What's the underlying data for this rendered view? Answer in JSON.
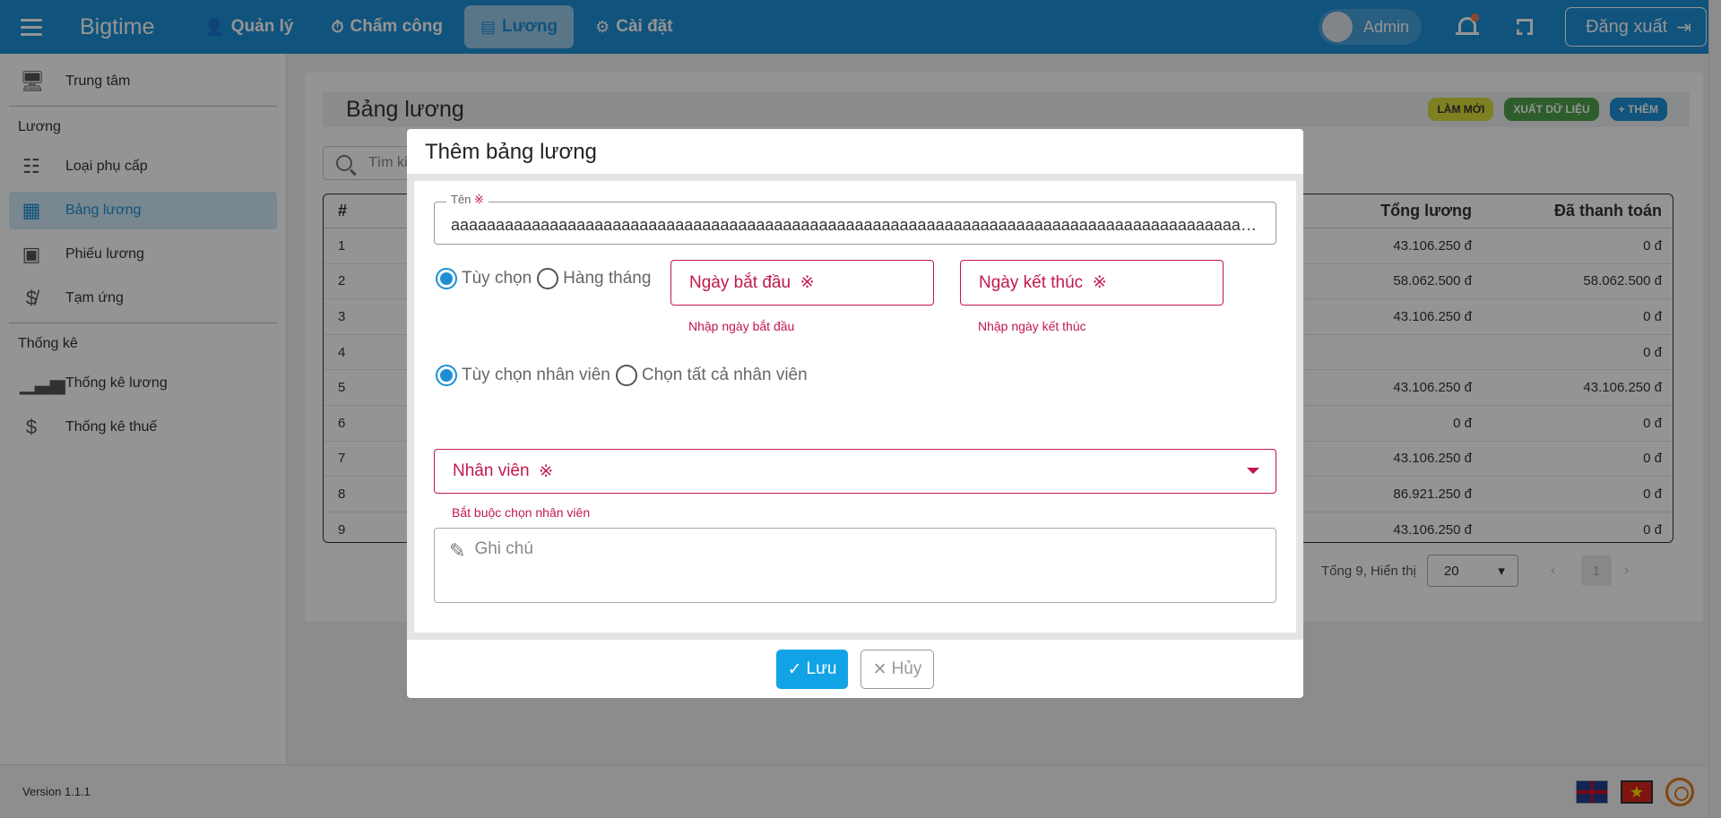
{
  "topbar": {
    "brand": "Bigtime",
    "nav": [
      {
        "label": "Quản lý",
        "icon": "manage-icon",
        "active": false
      },
      {
        "label": "Chấm công",
        "icon": "stopwatch-icon",
        "active": false
      },
      {
        "label": "Lương",
        "icon": "salary-icon",
        "active": true
      },
      {
        "label": "Cài đặt",
        "icon": "gears-icon",
        "active": false
      }
    ],
    "user": "Admin",
    "logout_label": "Đăng xuất"
  },
  "sidebar": {
    "items": [
      {
        "label": "Trung tâm",
        "icon": "monitor-icon"
      }
    ],
    "section_salary": "Lương",
    "salary_items": [
      {
        "label": "Loại phụ cấp",
        "icon": "list-icon"
      },
      {
        "label": "Bảng lương",
        "icon": "sheet-icon",
        "active": true
      },
      {
        "label": "Phiếu lương",
        "icon": "payslip-icon"
      },
      {
        "label": "Tạm ứng",
        "icon": "no-money-icon"
      }
    ],
    "section_stats": "Thống kê",
    "stats_items": [
      {
        "label": "Thống kê lương",
        "icon": "bar-chart-icon"
      },
      {
        "label": "Thống kê thuế",
        "icon": "dollar-icon"
      }
    ]
  },
  "main": {
    "title": "Bảng lương",
    "actions": {
      "refresh": "LÀM MỚI",
      "export": "XUẤT DỮ LIỆU",
      "add": "+ THÊM"
    },
    "search_placeholder": "Tìm kiếm",
    "table": {
      "headers": {
        "index": "#",
        "total": "Tổng lương",
        "paid": "Đã thanh toán"
      },
      "rows": [
        {
          "index": "1",
          "total": "43.106.250 đ",
          "paid": "0 đ"
        },
        {
          "index": "2",
          "total": "58.062.500 đ",
          "paid": "58.062.500 đ"
        },
        {
          "index": "3",
          "total": "43.106.250 đ",
          "paid": "0 đ"
        },
        {
          "index": "4",
          "total": "",
          "paid": "0 đ"
        },
        {
          "index": "5",
          "total": "43.106.250 đ",
          "paid": "43.106.250 đ"
        },
        {
          "index": "6",
          "total": "0 đ",
          "paid": "0 đ"
        },
        {
          "index": "7",
          "total": "43.106.250 đ",
          "paid": "0 đ"
        },
        {
          "index": "8",
          "total": "86.921.250 đ",
          "paid": "0 đ"
        },
        {
          "index": "9",
          "total": "43.106.250 đ",
          "paid": "0 đ"
        }
      ]
    },
    "pager": {
      "summary": "Tổng 9,  Hiển thị",
      "page_size": "20",
      "page": "1"
    }
  },
  "footer": {
    "version": "Version 1.1.1",
    "flag_vn": "★"
  },
  "dialog": {
    "title": "Thêm bảng lương",
    "name_label": "Tên",
    "required_mark": "※",
    "name_value": "aaaaaaaaaaaaaaaaaaaaaaaaaaaaaaaaaaaaaaaaaaaaaaaaaaaaaaaaaaaaaaaaaaaaaaaaaaaaaaaaaaaaaaaaaaaaaaaaaaaaaaa",
    "period_options": [
      {
        "label": "Tùy chọn",
        "selected": true
      },
      {
        "label": "Hàng tháng",
        "selected": false
      }
    ],
    "start_date_label": "Ngày bắt đầu",
    "start_date_error": "Nhập ngày bắt đầu",
    "end_date_label": "Ngày kết thúc",
    "end_date_error": "Nhập ngày kết thúc",
    "employee_options": [
      {
        "label": "Tùy chọn nhân viên",
        "selected": true
      },
      {
        "label": "Chọn tất cả nhân viên",
        "selected": false
      }
    ],
    "employee_label": "Nhân viên",
    "employee_error": "Bắt buộc chọn nhân viên",
    "note_placeholder": "Ghi chú",
    "save_label": "Lưu",
    "cancel_label": "Hủy"
  },
  "colors": {
    "primary": "#1d8fd6",
    "error": "#c2184b",
    "save": "#12a3e7"
  }
}
